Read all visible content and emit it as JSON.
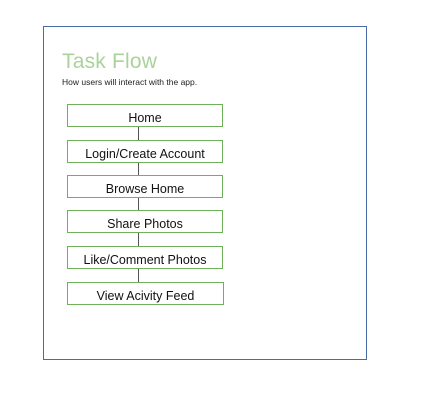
{
  "diagram": {
    "title": "Task Flow",
    "subtitle": "How users will interact with the app.",
    "steps": [
      {
        "label": "Home"
      },
      {
        "label": "Login/Create Account"
      },
      {
        "label": "Browse Home"
      },
      {
        "label": "Share Photos"
      },
      {
        "label": "Like/Comment Photos"
      },
      {
        "label": "View Acivity Feed"
      }
    ],
    "colors": {
      "frame_border": "#4a6aa8",
      "title": "#a9d39a",
      "step_border": "#6fb05a",
      "connector": "#555555"
    }
  }
}
